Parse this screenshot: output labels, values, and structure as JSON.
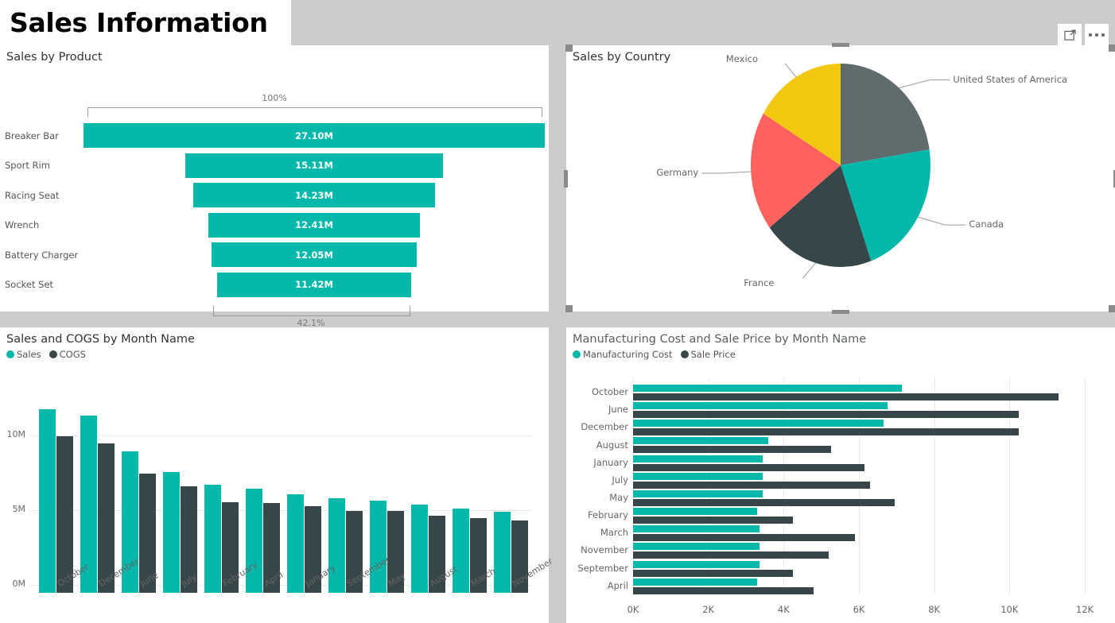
{
  "report": {
    "title": "Sales Information"
  },
  "toolbar": {
    "focus_mode_label": "Focus mode",
    "more_options_label": "More options"
  },
  "colors": {
    "teal": "#01b8aa",
    "dark_slate": "#374649",
    "gray": "#5f6b6d",
    "yellow": "#f2c811",
    "red": "#fd625e",
    "canvas": "#cccccc",
    "panel": "#ffffff"
  },
  "funnel": {
    "title": "Sales by Product",
    "top_label": "100%",
    "bottom_label": "42.1%",
    "chart_data": {
      "type": "bar",
      "subtype": "funnel",
      "title": "Sales by Product",
      "categories": [
        "Breaker Bar",
        "Sport Rim",
        "Racing Seat",
        "Wrench",
        "Battery Charger",
        "Socket Set"
      ],
      "values": [
        27.1,
        15.11,
        14.23,
        12.41,
        12.05,
        11.42
      ],
      "value_labels": [
        "27.10M",
        "15.11M",
        "14.23M",
        "12.41M",
        "12.05M",
        "11.42M"
      ],
      "unit": "M",
      "widths_pct": [
        100.0,
        55.8,
        52.5,
        45.8,
        44.5,
        42.1
      ],
      "first_percent": "100%",
      "last_percent": "42.1%",
      "xlabel": "",
      "ylabel": "",
      "legend": false
    }
  },
  "pie": {
    "title": "Sales by Country",
    "selected": true,
    "chart_data": {
      "type": "pie",
      "title": "Sales by Country",
      "categories": [
        "United States of America",
        "Canada",
        "France",
        "Germany",
        "Mexico"
      ],
      "values": [
        22.5,
        22.0,
        20.0,
        19.0,
        16.5
      ],
      "colors": [
        "#5f6b6d",
        "#01b8aa",
        "#374649",
        "#fd625e",
        "#f2c811"
      ],
      "legend": "labels-with-leader-lines",
      "start_angle_deg": 0
    }
  },
  "column": {
    "title": "Sales and COGS by Month Name",
    "legend": [
      {
        "label": "Sales",
        "color": "#01b8aa"
      },
      {
        "label": "COGS",
        "color": "#374649"
      }
    ],
    "chart_data": {
      "type": "bar",
      "subtype": "grouped-column",
      "title": "Sales and COGS by Month Name",
      "categories": [
        "October",
        "December",
        "June",
        "July",
        "February",
        "April",
        "January",
        "September",
        "May",
        "August",
        "March",
        "November"
      ],
      "series": [
        {
          "name": "Sales",
          "color": "#01b8aa",
          "values": [
            12.3,
            11.9,
            9.5,
            8.1,
            7.25,
            7.0,
            6.6,
            6.35,
            6.2,
            5.9,
            5.65,
            5.45
          ]
        },
        {
          "name": "COGS",
          "color": "#374649",
          "values": [
            10.5,
            10.0,
            8.0,
            7.15,
            6.1,
            6.0,
            5.8,
            5.5,
            5.5,
            5.15,
            5.0,
            4.85
          ]
        }
      ],
      "yticks": [
        "0M",
        "5M",
        "10M"
      ],
      "ytick_values": [
        0,
        5,
        10
      ],
      "ylim": [
        0,
        13
      ],
      "xlabel": "",
      "ylabel": "",
      "grid": true,
      "legend_position": "top-left"
    }
  },
  "hbar": {
    "title": "Manufacturing Cost and Sale Price by Month Name",
    "legend": [
      {
        "label": "Manufacturing Cost",
        "color": "#01b8aa"
      },
      {
        "label": "Sale Price",
        "color": "#374649"
      }
    ],
    "chart_data": {
      "type": "bar",
      "subtype": "grouped-horizontal-bar",
      "title": "Manufacturing Cost and Sale Price by Month Name",
      "categories": [
        "October",
        "June",
        "December",
        "August",
        "January",
        "July",
        "May",
        "February",
        "March",
        "November",
        "September",
        "April"
      ],
      "series": [
        {
          "name": "Manufacturing Cost",
          "color": "#01b8aa",
          "values": [
            7150,
            6750,
            6650,
            3600,
            3450,
            3450,
            3450,
            3300,
            3350,
            3350,
            3350,
            3300
          ]
        },
        {
          "name": "Sale Price",
          "color": "#374649",
          "values": [
            11300,
            10250,
            10250,
            5250,
            6150,
            6300,
            6950,
            4250,
            5900,
            5200,
            4250,
            4800
          ]
        }
      ],
      "xticks": [
        "0K",
        "2K",
        "4K",
        "6K",
        "8K",
        "10K",
        "12K"
      ],
      "xtick_values": [
        0,
        2000,
        4000,
        6000,
        8000,
        10000,
        12000
      ],
      "xlim": [
        0,
        12000
      ],
      "xlabel": "",
      "ylabel": "",
      "grid": true,
      "legend_position": "top-left"
    }
  }
}
